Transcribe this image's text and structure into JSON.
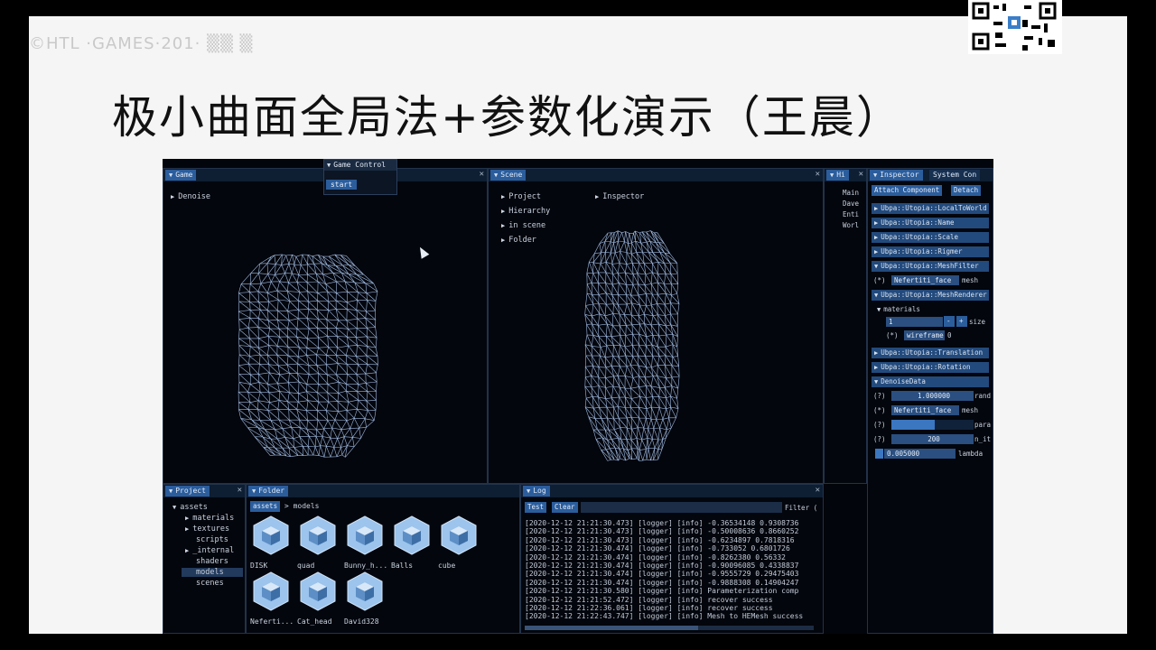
{
  "slide": {
    "watermark": "©HTL  ·GAMES·201·  ▒▒ ▒",
    "title": "极小曲面全局法+参数化演示（王晨）"
  },
  "game_panel": {
    "tab": "Game",
    "tree": [
      "Denoise"
    ]
  },
  "game_control": {
    "title": "Game Control",
    "start_label": "start"
  },
  "scene_panel": {
    "tab": "Scene",
    "tree_left": [
      "Project",
      "Hierarchy",
      "in scene",
      "Folder"
    ],
    "tree_right": [
      "Inspector"
    ]
  },
  "hierarchy_panel": {
    "tab": "Hi",
    "items": [
      "Main",
      "Dave",
      "Enti",
      "Worl"
    ]
  },
  "inspector_panel": {
    "tabs": [
      "Inspector",
      "System Con"
    ],
    "attach_label": "Attach Component",
    "detach_label": "Detach",
    "components": [
      "Ubpa::Utopia::LocalToWorld",
      "Ubpa::Utopia::Name",
      "Ubpa::Utopia::Scale",
      "Ubpa::Utopia::Rigmer",
      "Ubpa::Utopia::MeshFilter"
    ],
    "meshfilter_field": "Nefertiti_face",
    "meshfilter_label": "mesh",
    "meshrenderer": "Ubpa::Utopia::MeshRenderer",
    "materials_label": "materials",
    "materials_count": "1",
    "size_label": "size",
    "wireframe_field": "wireframe",
    "wireframe_index": "0",
    "translation": "Ubpa::Utopia::Translation",
    "rotation": "Ubpa::Utopia::Rotation",
    "denoise": "DenoiseData",
    "rand_value": "1.000000",
    "rand_label": "rand",
    "mesh_field": "Nefertiti_face",
    "mesh_label": "mesh",
    "para_label": "para",
    "n_iter_value": "200",
    "n_iter_label": "n_it",
    "lambda_value": "0.005000",
    "lambda_label": "lambda",
    "hints": [
      "(?)",
      "(*)",
      "(?)",
      "(?)",
      "(?)"
    ]
  },
  "project_panel": {
    "tab": "Project",
    "root": "assets",
    "children": [
      "materials",
      "textures",
      "scripts",
      "_internal",
      "shaders",
      "models",
      "scenes"
    ],
    "selected": "models"
  },
  "folder_panel": {
    "tab": "Folder",
    "breadcrumb_root": "assets",
    "breadcrumb_sep": ">",
    "breadcrumb_leaf": "models",
    "assets": [
      "DISK",
      "quad",
      "Bunny_h...",
      "Balls",
      "cube",
      "Neferti...",
      "Cat_head",
      "David328"
    ]
  },
  "log_panel": {
    "tab": "Log",
    "test_label": "Test",
    "clear_label": "Clear",
    "filter_label": "Filter (",
    "lines": [
      "[2020-12-12 21:21:30.473] [logger] [info] -0.36534148 0.9308736",
      "[2020-12-12 21:21:30.473] [logger] [info] -0.50008636 0.8660252",
      "[2020-12-12 21:21:30.473] [logger] [info] -0.6234897 0.7818316",
      "[2020-12-12 21:21:30.474] [logger] [info] -0.733052 0.6801726",
      "[2020-12-12 21:21:30.474] [logger] [info] -0.8262380 0.56332",
      "[2020-12-12 21:21:30.474] [logger] [info] -0.90096085 0.4338837",
      "[2020-12-12 21:21:30.474] [logger] [info] -0.9555729 0.29475403",
      "[2020-12-12 21:21:30.474] [logger] [info] -0.9888308 0.14904247",
      "[2020-12-12 21:21:30.580] [logger] [info] Parameterization comp",
      "[2020-12-12 21:21:52.472] [logger] [info] recover success",
      "[2020-12-12 21:22:36.061] [logger] [info] recover success",
      "[2020-12-12 21:22:43.747] [logger] [info] Mesh to HEMesh success"
    ]
  },
  "colors": {
    "panel_bg": "#03060d",
    "tab_active": "#2b5d9c",
    "header_row": "#234a7c",
    "wireframe": "#9fb8df"
  }
}
